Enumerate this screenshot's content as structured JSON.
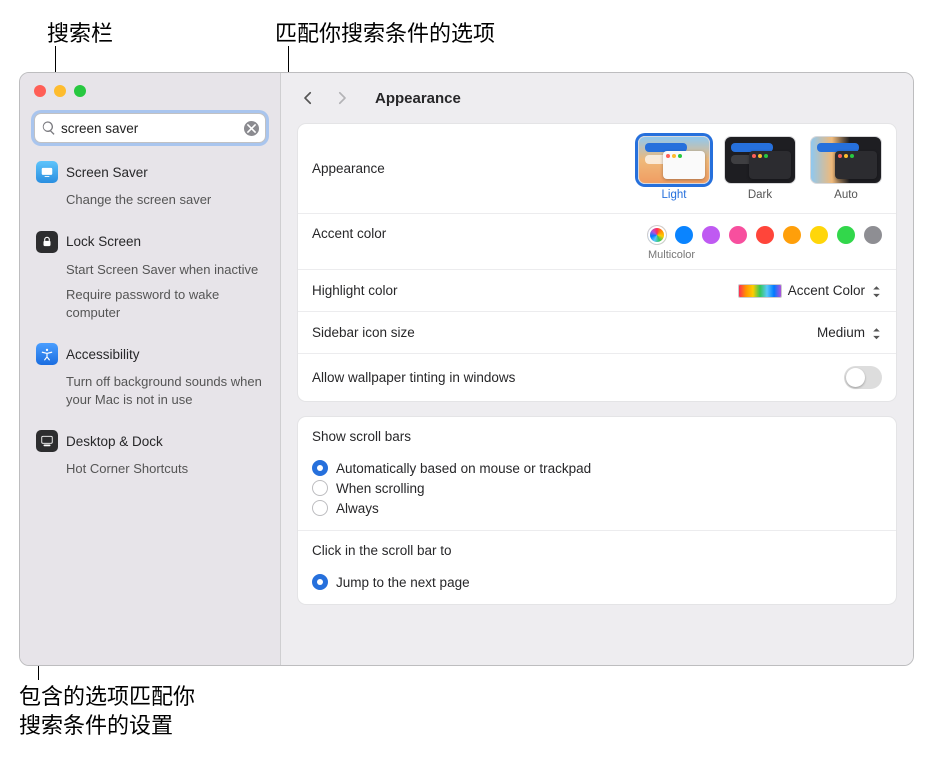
{
  "annotations": {
    "search_bar": "搜索栏",
    "matching_items": "匹配你搜索条件的选项",
    "settings_contain": "包含的选项匹配你\n搜索条件的设置"
  },
  "search": {
    "value": "screen saver"
  },
  "sidebar": {
    "groups": [
      {
        "icon": "screensaver",
        "title": "Screen Saver",
        "items": [
          "Change the screen saver"
        ]
      },
      {
        "icon": "lock",
        "title": "Lock Screen",
        "items": [
          "Start Screen Saver when inactive",
          "Require password to wake computer"
        ]
      },
      {
        "icon": "accessibility",
        "title": "Accessibility",
        "items": [
          "Turn off background sounds when your Mac is not in use"
        ]
      },
      {
        "icon": "desktop",
        "title": "Desktop & Dock",
        "items": [
          "Hot Corner Shortcuts"
        ]
      }
    ]
  },
  "page": {
    "title": "Appearance",
    "appearance_label": "Appearance",
    "appearance_opts": [
      {
        "label": "Light",
        "selected": true
      },
      {
        "label": "Dark",
        "selected": false
      },
      {
        "label": "Auto",
        "selected": false
      }
    ],
    "accent_label": "Accent color",
    "accent_selected_label": "Multicolor",
    "accent_colors": [
      {
        "name": "multicolor",
        "css": "multi",
        "selected": true
      },
      {
        "name": "blue",
        "css": "#0a84ff"
      },
      {
        "name": "purple",
        "css": "#bf5af2"
      },
      {
        "name": "pink",
        "css": "#f74f9e"
      },
      {
        "name": "red",
        "css": "#ff453a"
      },
      {
        "name": "orange",
        "css": "#ff9f0a"
      },
      {
        "name": "yellow",
        "css": "#ffd60a"
      },
      {
        "name": "green",
        "css": "#32d74b"
      },
      {
        "name": "graphite",
        "css": "#8e8e93"
      }
    ],
    "highlight_label": "Highlight color",
    "highlight_value": "Accent Color",
    "sidebar_size_label": "Sidebar icon size",
    "sidebar_size_value": "Medium",
    "wallpaper_tint_label": "Allow wallpaper tinting in windows",
    "wallpaper_tint_on": false,
    "scrollbars": {
      "title": "Show scroll bars",
      "options": [
        {
          "label": "Automatically based on mouse or trackpad",
          "selected": true
        },
        {
          "label": "When scrolling",
          "selected": false
        },
        {
          "label": "Always",
          "selected": false
        }
      ]
    },
    "click_scroll": {
      "title": "Click in the scroll bar to",
      "options": [
        {
          "label": "Jump to the next page",
          "selected": true
        }
      ]
    }
  }
}
